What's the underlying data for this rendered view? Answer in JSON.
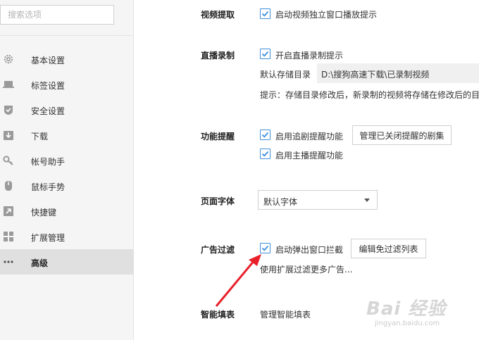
{
  "sidebar": {
    "search_placeholder": "搜索选项",
    "items": [
      {
        "label": "基本设置",
        "icon": "gear-icon"
      },
      {
        "label": "标签设置",
        "icon": "laptop-icon"
      },
      {
        "label": "安全设置",
        "icon": "shield-check-icon"
      },
      {
        "label": "下载",
        "icon": "download-icon"
      },
      {
        "label": "帐号助手",
        "icon": "key-icon"
      },
      {
        "label": "鼠标手势",
        "icon": "mouse-icon"
      },
      {
        "label": "快捷键",
        "icon": "shortcut-arrow-icon"
      },
      {
        "label": "扩展管理",
        "icon": "extensions-icon"
      },
      {
        "label": "高级",
        "icon": "more-dots-icon",
        "active": true
      }
    ]
  },
  "video": {
    "title": "视频提取",
    "checkbox_label": "启动视频独立窗口播放提示",
    "checked": true
  },
  "live": {
    "title": "直播录制",
    "checkbox_label": "开启直播录制提示",
    "checked": true,
    "storage_label": "默认存储目录",
    "storage_path": "D:\\搜狗高速下载\\已录制视频",
    "hint": "提示：存储目录修改后，新录制的视频将存储在修改后的目"
  },
  "reminder": {
    "title": "功能提醒",
    "option1": "启用追剧提醒功能",
    "option1_checked": true,
    "manage_button": "管理已关闭提醒的剧集",
    "option2": "启用主播提醒功能",
    "option2_checked": true
  },
  "font": {
    "title": "页面字体",
    "selected": "默认字体"
  },
  "adblock": {
    "title": "广告过滤",
    "checkbox_label": "启动弹出窗口拦截",
    "checked": true,
    "edit_button": "编辑免过滤列表",
    "extension_link": "使用扩展过滤更多广告..."
  },
  "autofill": {
    "title": "智能填表",
    "manage_link": "管理智能填表"
  },
  "watermark": {
    "main": "Bai 经验",
    "sub": "jingyan.baidu.com"
  },
  "colors": {
    "accent": "#3f8fdc",
    "arrow": "#e8202a"
  }
}
